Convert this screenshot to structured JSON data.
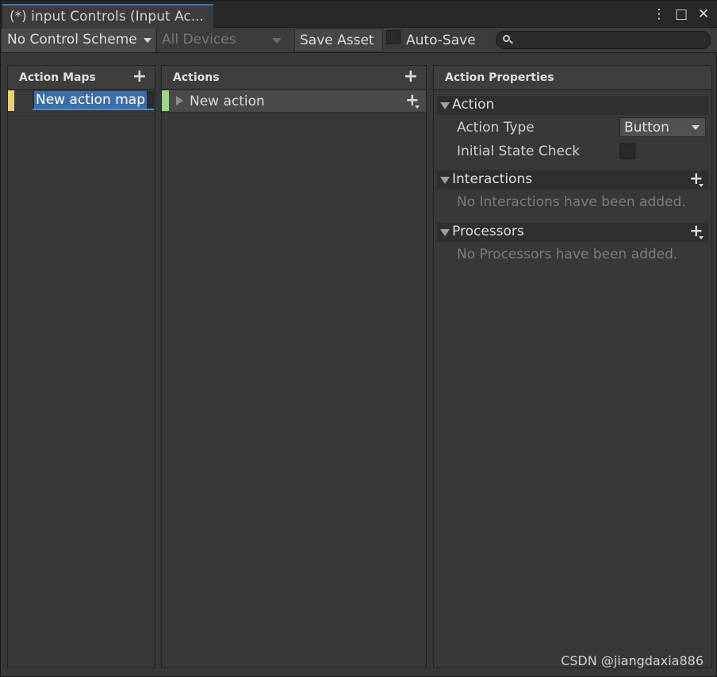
{
  "window": {
    "tab_title": "(*) input Controls (Input Ac...",
    "buttons": {
      "menu": "⋮",
      "maximize": "□",
      "close": "✕"
    }
  },
  "toolbar": {
    "control_scheme": "No Control Scheme",
    "devices": "All Devices",
    "save_asset": "Save Asset",
    "auto_save": "Auto-Save",
    "auto_save_checked": false,
    "search_value": ""
  },
  "action_maps": {
    "header": "Action Maps",
    "items": [
      {
        "label": "New action map",
        "color": "#f0cf72",
        "editing": true
      }
    ]
  },
  "actions": {
    "header": "Actions",
    "items": [
      {
        "label": "New action",
        "color": "#9fd48a"
      }
    ]
  },
  "properties": {
    "header": "Action Properties",
    "action_section": {
      "title": "Action",
      "action_type_label": "Action Type",
      "action_type_value": "Button",
      "initial_state_label": "Initial State Check",
      "initial_state_checked": false
    },
    "interactions": {
      "title": "Interactions",
      "empty": "No Interactions have been added."
    },
    "processors": {
      "title": "Processors",
      "empty": "No Processors have been added."
    }
  },
  "watermark": "CSDN @jiangdaxia886",
  "colors": {
    "accent": "#3a79bb",
    "selection": "#3e6ea8",
    "map": "#f0cf72",
    "action": "#9fd48a"
  }
}
